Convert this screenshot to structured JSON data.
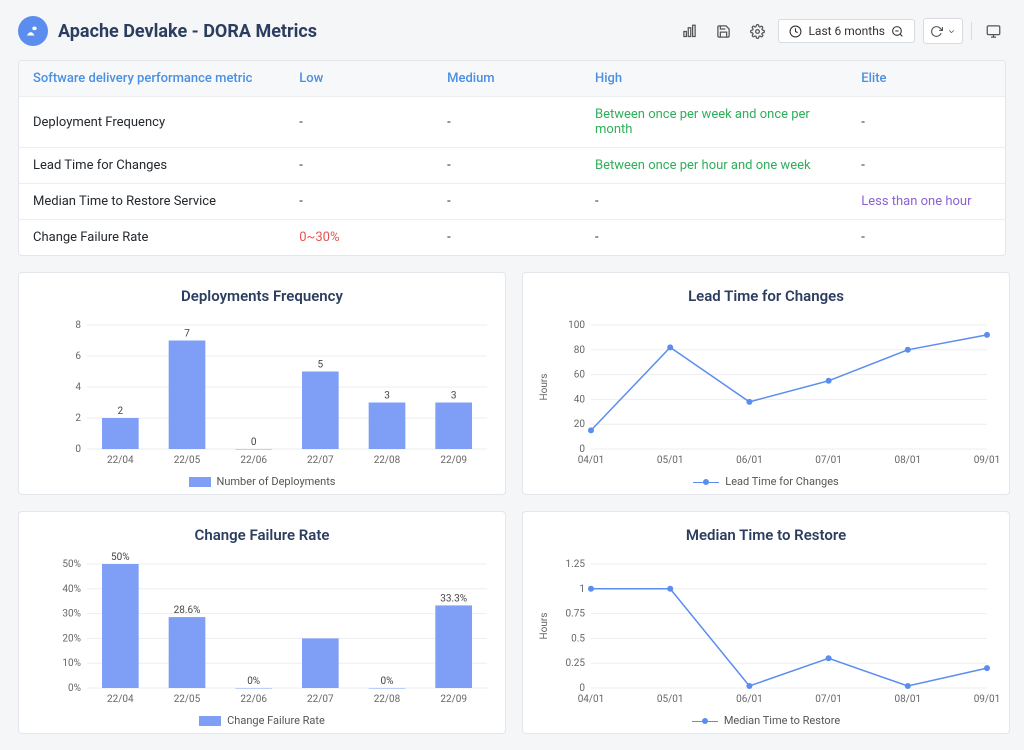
{
  "header": {
    "title": "Apache Devlake - DORA Metrics",
    "range_label": "Last 6 months"
  },
  "table": {
    "headers": [
      "Software delivery performance metric",
      "Low",
      "Medium",
      "High",
      "Elite"
    ],
    "rows": [
      {
        "metric": "Deployment Frequency",
        "low": "-",
        "medium": "-",
        "high": "Between once per week and once per month",
        "elite": "-",
        "high_class": "val-green"
      },
      {
        "metric": "Lead Time for Changes",
        "low": "-",
        "medium": "-",
        "high": "Between once per hour and one week",
        "elite": "-",
        "high_class": "val-green"
      },
      {
        "metric": "Median Time to Restore Service",
        "low": "-",
        "medium": "-",
        "high": "-",
        "elite": "Less than one hour",
        "elite_class": "val-purple"
      },
      {
        "metric": "Change Failure Rate",
        "low": "0~30%",
        "medium": "-",
        "high": "-",
        "elite": "-",
        "low_class": "val-red"
      }
    ]
  },
  "charts": {
    "deployments": {
      "title": "Deployments Frequency",
      "legend": "Number of Deployments"
    },
    "lead_time": {
      "title": "Lead Time for Changes",
      "legend": "Lead Time for Changes",
      "ylabel": "Hours"
    },
    "cfr": {
      "title": "Change Failure Rate",
      "legend": "Change Failure Rate"
    },
    "mttr": {
      "title": "Median Time to Restore",
      "legend": "Median Time to Restore",
      "ylabel": "Hours"
    }
  },
  "chart_data": [
    {
      "id": "deployments",
      "type": "bar",
      "title": "Deployments Frequency",
      "categories": [
        "22/04",
        "22/05",
        "22/06",
        "22/07",
        "22/08",
        "22/09"
      ],
      "values": [
        2,
        7,
        0,
        5,
        3,
        3
      ],
      "labels": [
        "2",
        "7",
        "0",
        "5",
        "3",
        "3"
      ],
      "yticks": [
        0,
        2,
        4,
        6,
        8
      ],
      "ylim": [
        0,
        8
      ],
      "legend": "Number of Deployments"
    },
    {
      "id": "lead_time",
      "type": "line",
      "title": "Lead Time for Changes",
      "x": [
        "04/01",
        "05/01",
        "06/01",
        "07/01",
        "08/01",
        "09/01"
      ],
      "values": [
        15,
        82,
        38,
        55,
        80,
        92
      ],
      "yticks": [
        0,
        20,
        40,
        60,
        80,
        100
      ],
      "ylim": [
        0,
        100
      ],
      "ylabel": "Hours",
      "legend": "Lead Time for Changes"
    },
    {
      "id": "cfr",
      "type": "bar",
      "title": "Change Failure Rate",
      "categories": [
        "22/04",
        "22/05",
        "22/06",
        "22/07",
        "22/08",
        "22/09"
      ],
      "values": [
        50,
        28.6,
        0,
        20,
        0,
        33.3
      ],
      "labels": [
        "50%",
        "28.6%",
        "0%",
        "",
        "0%",
        "33.3%"
      ],
      "yticks": [
        0,
        10,
        20,
        30,
        40,
        50
      ],
      "ylim": [
        0,
        50
      ],
      "legend": "Change Failure Rate",
      "ylabel_suffix": "%"
    },
    {
      "id": "mttr",
      "type": "line",
      "title": "Median Time to Restore",
      "x": [
        "04/01",
        "05/01",
        "06/01",
        "07/01",
        "08/01",
        "09/01"
      ],
      "values": [
        1,
        1,
        0.02,
        0.3,
        0.02,
        0.2
      ],
      "yticks": [
        0,
        0.25,
        0.5,
        0.75,
        1,
        1.25
      ],
      "ylim": [
        0,
        1.25
      ],
      "ylabel": "Hours",
      "legend": "Median Time to Restore"
    }
  ]
}
